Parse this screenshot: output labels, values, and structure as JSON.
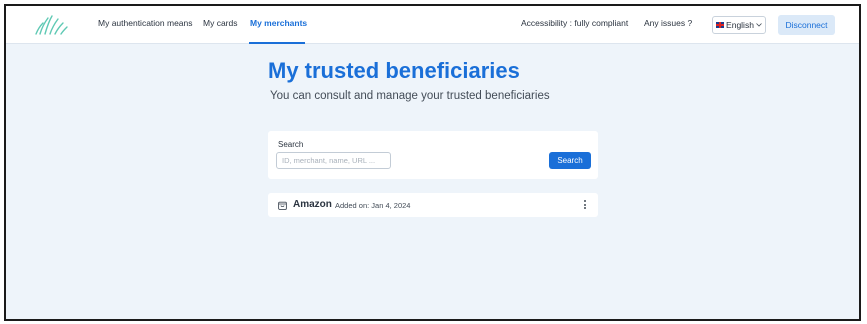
{
  "header": {
    "nav": [
      {
        "label": "My authentication means"
      },
      {
        "label": "My cards"
      },
      {
        "label": "My merchants"
      }
    ],
    "accessibility": "Accessibility : fully compliant",
    "issues": "Any issues ?",
    "language": "English",
    "disconnect": "Disconnect"
  },
  "main": {
    "title": "My trusted beneficiaries",
    "subtitle": "You can consult and manage your trusted beneficiaries",
    "search": {
      "label": "Search",
      "placeholder": "ID, merchant, name, URL ...",
      "value": "",
      "button": "Search"
    },
    "merchants": [
      {
        "name": "Amazon",
        "added": "Added on: Jan 4, 2024"
      }
    ]
  },
  "colors": {
    "accent": "#1a6fd8",
    "background": "#eef4fa",
    "logo": "#5fc9b4"
  }
}
